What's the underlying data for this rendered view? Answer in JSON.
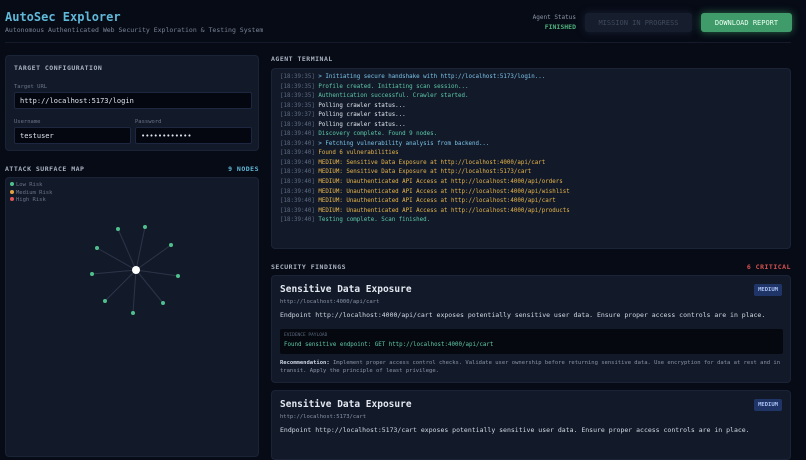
{
  "header": {
    "title": "AutoSec Explorer",
    "subtitle": "Autonomous Authenticated Web Security Exploration & Testing System",
    "status_label": "Agent Status",
    "status_value": "FINISHED",
    "mission_button": "MISSION IN PROGRESS",
    "download_button": "DOWNLOAD REPORT"
  },
  "config": {
    "title": "TARGET CONFIGURATION",
    "url_label": "Target URL",
    "url_value": "http://localhost:5173/login",
    "username_label": "Username",
    "username_value": "testuser",
    "password_label": "Password",
    "password_value": "••••••••••••"
  },
  "map": {
    "title": "ATTACK SURFACE MAP",
    "count": "9 NODES",
    "legend": [
      {
        "label": "Low Risk",
        "color": "#4fc08d"
      },
      {
        "label": "Medium Risk",
        "color": "#e0a340"
      },
      {
        "label": "High Risk",
        "color": "#e05555"
      }
    ],
    "node_color": "#4fc08d",
    "node_count": 9
  },
  "terminal": {
    "title": "AGENT TERMINAL",
    "lines": [
      {
        "ts": "[18:39:35]",
        "text": "> Initiating secure handshake with http://localhost:5173/login...",
        "color": "#7cc4e8"
      },
      {
        "ts": "[18:39:35]",
        "text": "Profile created. Initiating scan session...",
        "color": "#5fc9a8"
      },
      {
        "ts": "[18:39:35]",
        "text": "Authentication successful. Crawler started.",
        "color": "#5fc9a8"
      },
      {
        "ts": "[18:39:35]",
        "text": "Polling crawler status...",
        "color": "#e4e9f1"
      },
      {
        "ts": "[18:39:37]",
        "text": "Polling crawler status...",
        "color": "#e4e9f1"
      },
      {
        "ts": "[18:39:40]",
        "text": "Polling crawler status...",
        "color": "#e4e9f1"
      },
      {
        "ts": "[18:39:40]",
        "text": "Discovery complete. Found 9 nodes.",
        "color": "#5fc9a8"
      },
      {
        "ts": "[18:39:40]",
        "text": "> Fetching vulnerability analysis from backend...",
        "color": "#7cc4e8"
      },
      {
        "ts": "[18:39:40]",
        "text": "Found 6 vulnerabilities",
        "color": "#e8b54a"
      },
      {
        "ts": "[18:39:40]",
        "text": "MEDIUM: Sensitive Data Exposure at http://localhost:4000/api/cart",
        "color": "#e8b54a"
      },
      {
        "ts": "[18:39:40]",
        "text": "MEDIUM: Sensitive Data Exposure at http://localhost:5173/cart",
        "color": "#e8b54a"
      },
      {
        "ts": "[18:39:40]",
        "text": "MEDIUM: Unauthenticated API Access at http://localhost:4000/api/orders",
        "color": "#e8b54a"
      },
      {
        "ts": "[18:39:40]",
        "text": "MEDIUM: Unauthenticated API Access at http://localhost:4000/api/wishlist",
        "color": "#e8b54a"
      },
      {
        "ts": "[18:39:40]",
        "text": "MEDIUM: Unauthenticated API Access at http://localhost:4000/api/cart",
        "color": "#e8b54a"
      },
      {
        "ts": "[18:39:40]",
        "text": "MEDIUM: Unauthenticated API Access at http://localhost:4000/api/products",
        "color": "#e8b54a"
      },
      {
        "ts": "[18:39:40]",
        "text": "Testing complete. Scan finished.",
        "color": "#5fc9a8"
      }
    ]
  },
  "findings": {
    "title": "SECURITY FINDINGS",
    "count": "6 CRITICAL",
    "items": [
      {
        "title": "Sensitive Data Exposure",
        "severity": "MEDIUM",
        "url": "http://localhost:4000/api/cart",
        "description": "Endpoint http://localhost:4000/api/cart exposes potentially sensitive user data. Ensure proper access controls are in place.",
        "evidence_label": "EVIDENCE PAYLOAD",
        "evidence": "Found sensitive endpoint: GET http://localhost:4000/api/cart",
        "rec_label": "Recommendation:",
        "recommendation": "Implement proper access control checks. Validate user ownership before returning sensitive data. Use encryption for data at rest and in transit. Apply the principle of least privilege."
      },
      {
        "title": "Sensitive Data Exposure",
        "severity": "MEDIUM",
        "url": "http://localhost:5173/cart",
        "description": "Endpoint http://localhost:5173/cart exposes potentially sensitive user data. Ensure proper access controls are in place."
      }
    ]
  }
}
